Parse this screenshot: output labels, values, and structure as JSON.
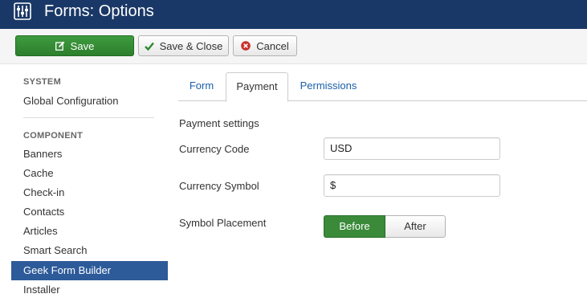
{
  "header": {
    "title": "Forms: Options",
    "icon": "sliders-icon"
  },
  "toolbar": {
    "save_label": "Save",
    "save_close_label": "Save & Close",
    "cancel_label": "Cancel",
    "colors": {
      "save": "#2f8a2f",
      "cancel_icon": "#c8302c"
    }
  },
  "sidebar": {
    "system_heading": "SYSTEM",
    "system_items": [
      "Global Configuration"
    ],
    "component_heading": "COMPONENT",
    "component_items": [
      "Banners",
      "Cache",
      "Check-in",
      "Contacts",
      "Articles",
      "Smart Search",
      "Geek Form Builder",
      "Installer"
    ],
    "active_item": "Geek Form Builder"
  },
  "tabs": {
    "items": [
      "Form",
      "Payment",
      "Permissions"
    ],
    "active": "Payment"
  },
  "payment": {
    "section_title": "Payment settings",
    "currency_code_label": "Currency Code",
    "currency_code_value": "USD",
    "currency_symbol_label": "Currency Symbol",
    "currency_symbol_value": "$",
    "placement_label": "Symbol Placement",
    "placement_options": [
      "Before",
      "After"
    ],
    "placement_selected": "Before"
  },
  "colors": {
    "header_bg": "#1a3867",
    "active_sidebar": "#2d5a99",
    "link": "#1a5fa8"
  }
}
